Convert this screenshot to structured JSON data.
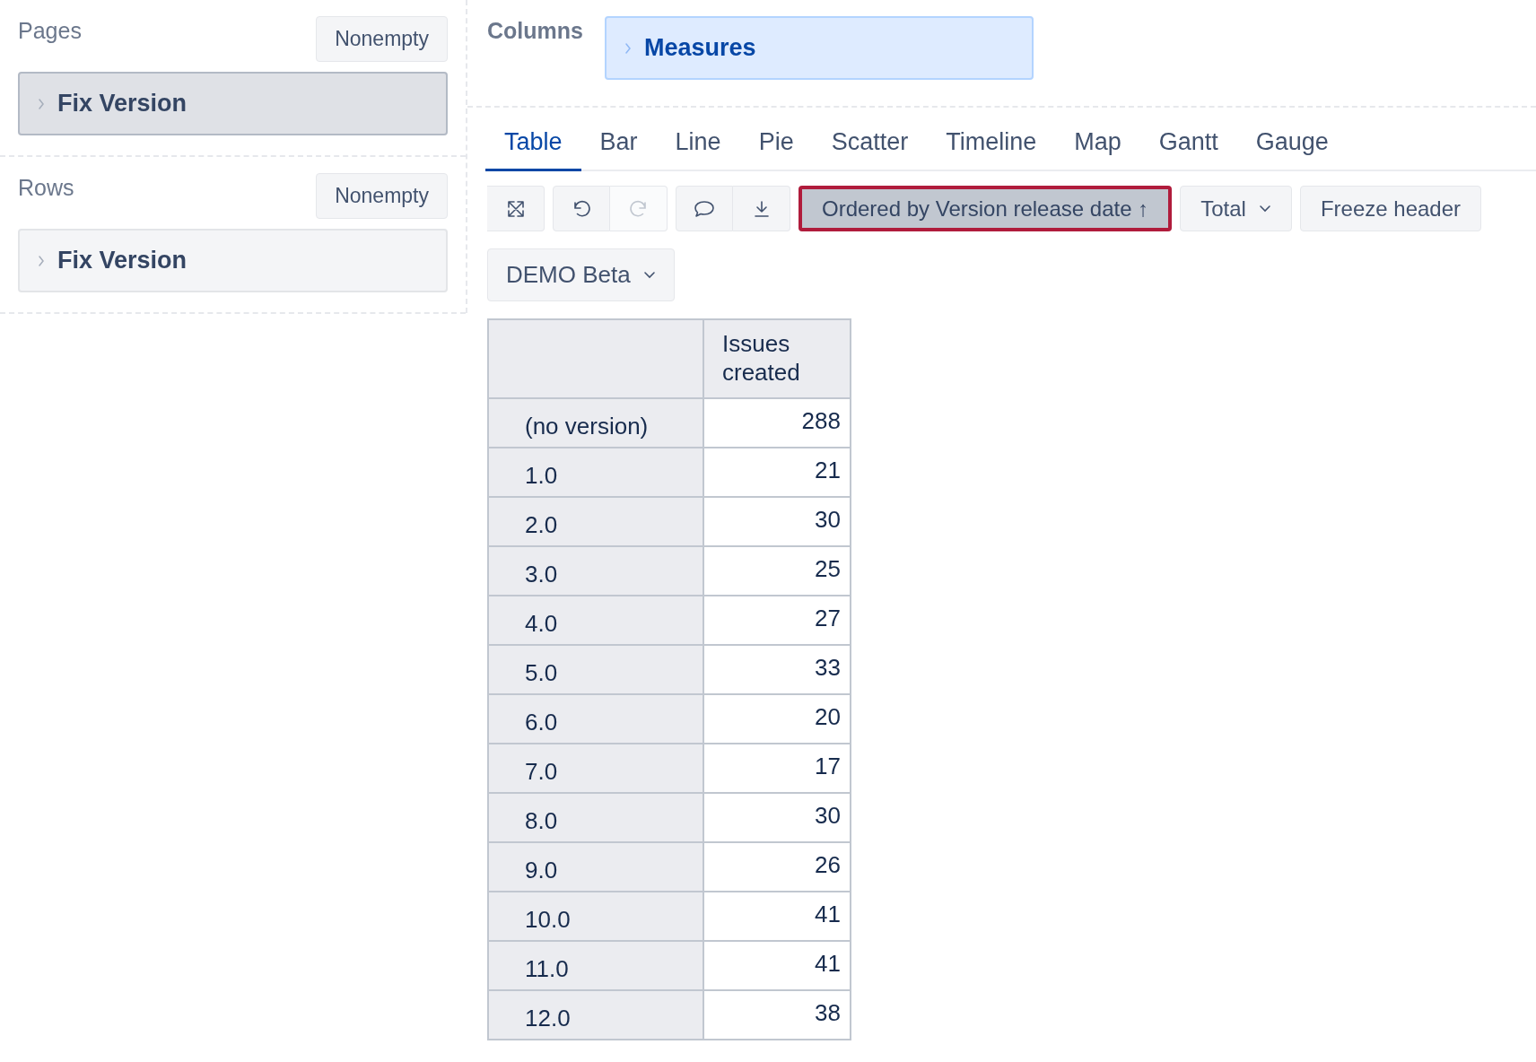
{
  "pages": {
    "title": "Pages",
    "nonempty_button": "Nonempty",
    "chips": [
      {
        "label": "Fix Version",
        "kind": "dimension",
        "selected": true
      }
    ]
  },
  "rows": {
    "title": "Rows",
    "nonempty_button": "Nonempty",
    "chips": [
      {
        "label": "Fix Version",
        "kind": "dimension",
        "selected": false
      }
    ]
  },
  "columns": {
    "title": "Columns",
    "chips": [
      {
        "label": "Measures",
        "kind": "measure",
        "selected": false
      }
    ]
  },
  "tabs": [
    {
      "label": "Table",
      "selected": true
    },
    {
      "label": "Bar",
      "selected": false
    },
    {
      "label": "Line",
      "selected": false
    },
    {
      "label": "Pie",
      "selected": false
    },
    {
      "label": "Scatter",
      "selected": false
    },
    {
      "label": "Timeline",
      "selected": false
    },
    {
      "label": "Map",
      "selected": false
    },
    {
      "label": "Gantt",
      "selected": false
    },
    {
      "label": "Gauge",
      "selected": false
    }
  ],
  "icon_buttons": [
    {
      "disabled": false
    },
    {
      "disabled": false
    },
    {
      "disabled": true
    },
    {
      "disabled": false
    },
    {
      "disabled": false
    }
  ],
  "text_buttons": [
    {
      "label": "Ordered by Version release date ↑",
      "kind": "plain",
      "active": true
    },
    {
      "label": "Total",
      "kind": "dropdown",
      "active": false
    },
    {
      "label": "Freeze header",
      "kind": "plain",
      "active": false
    }
  ],
  "page_selector": {
    "label": "DEMO Beta"
  },
  "table": {
    "columns": [
      "Issues created"
    ],
    "rows": [
      {
        "label": "(no version)",
        "value": "288"
      },
      {
        "label": "1.0",
        "value": "21"
      },
      {
        "label": "2.0",
        "value": "30"
      },
      {
        "label": "3.0",
        "value": "25"
      },
      {
        "label": "4.0",
        "value": "27"
      },
      {
        "label": "5.0",
        "value": "33"
      },
      {
        "label": "6.0",
        "value": "20"
      },
      {
        "label": "7.0",
        "value": "17"
      },
      {
        "label": "8.0",
        "value": "30"
      },
      {
        "label": "9.0",
        "value": "26"
      },
      {
        "label": "10.0",
        "value": "41"
      },
      {
        "label": "11.0",
        "value": "41"
      },
      {
        "label": "12.0",
        "value": "38"
      }
    ]
  }
}
